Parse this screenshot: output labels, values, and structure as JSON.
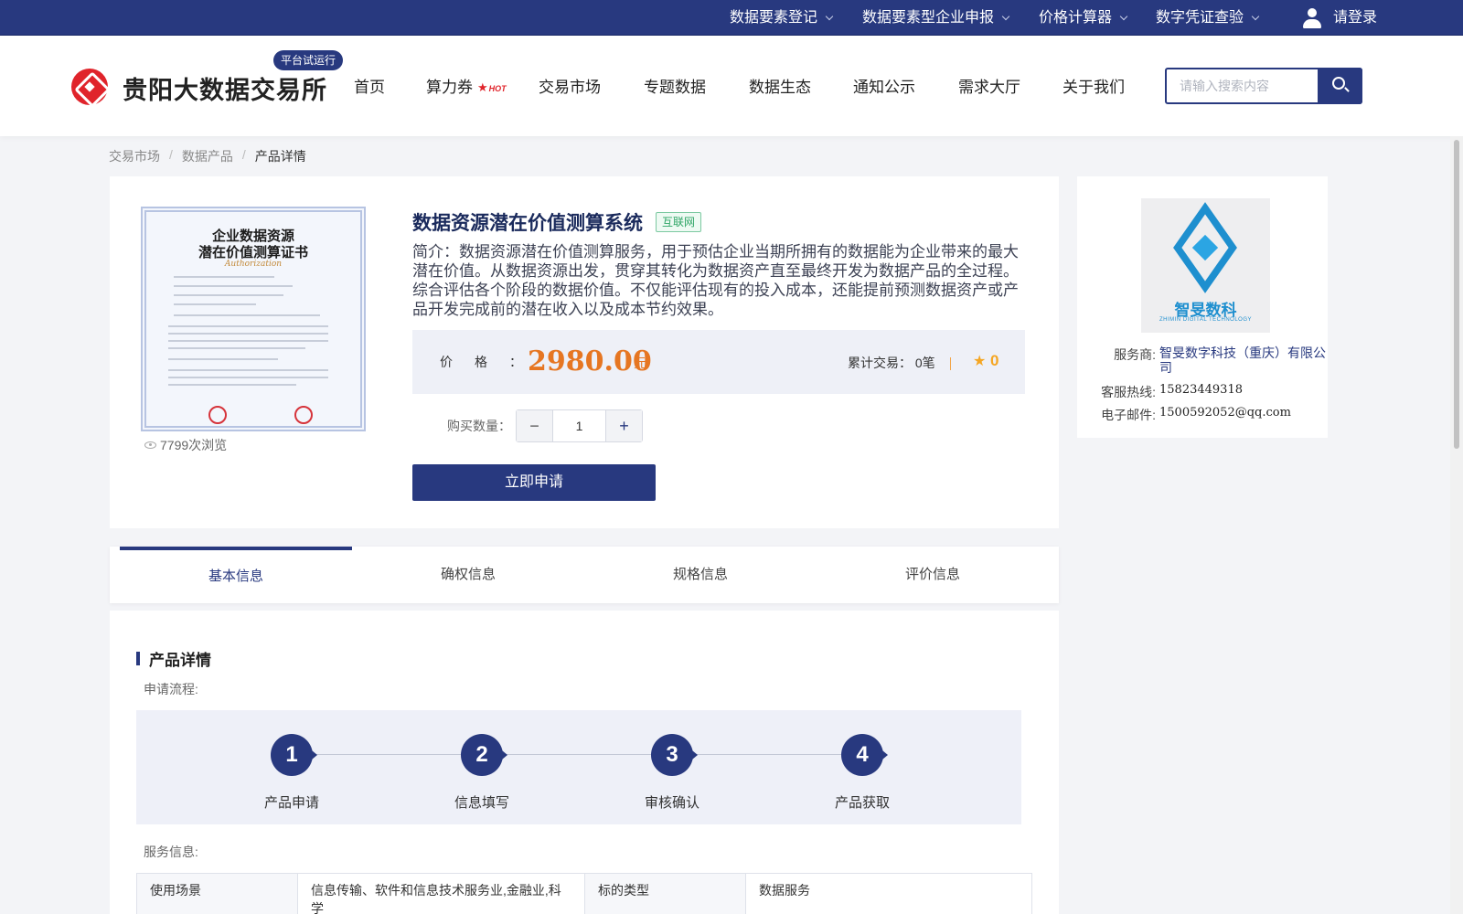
{
  "topbar": {
    "items": [
      {
        "label": "数据要素登记"
      },
      {
        "label": "数据要素型企业申报"
      },
      {
        "label": "价格计算器"
      },
      {
        "label": "数字凭证查验"
      }
    ],
    "login": "请登录"
  },
  "header": {
    "logo_text": "贵阳大数据交易所",
    "trial_badge": "平台试运行",
    "nav": [
      "首页",
      "算力券",
      "交易市场",
      "专题数据",
      "数据生态",
      "通知公示",
      "需求大厅",
      "关于我们"
    ],
    "hot_badge": "HOT",
    "search_placeholder": "请输入搜索内容"
  },
  "breadcrumb": [
    "交易市场",
    "数据产品",
    "产品详情"
  ],
  "product": {
    "certificate": {
      "title_line1": "企业数据资源",
      "title_line2": "潜在价值测算证书",
      "subtitle": "Authorization"
    },
    "views": "7799次浏览",
    "title": "数据资源潜在价值测算系统",
    "tag": "互联网",
    "intro": "简介：数据资源潜在价值测算服务，用于预估企业当期所拥有的数据能为企业带来的最大潜在价值。从数据资源出发，贯穿其转化为数据资产直至最终开发为数据产品的全过程。综合评估各个阶段的数据价值。不仅能评估现有的投入成本，还能提前预测数据资产或产品开发完成前的潜在收入以及成本节约效果。",
    "price_label": "价格：",
    "price": "2980.00",
    "price_unit": "元",
    "trades": "累计交易：  0笔",
    "rating": "0",
    "qty_label": "购买数量：",
    "qty_minus": "−",
    "qty_value": "1",
    "qty_plus": "+",
    "apply": "立即申请"
  },
  "provider": {
    "logo_name": "智旻数科",
    "logo_eng": "ZHIMIN DIGITAL TECHNOLOGY",
    "rows": [
      {
        "key": "服务商:",
        "value": "智旻数字科技（重庆）有限公司"
      },
      {
        "key": "客服热线:",
        "value": "15823449318"
      },
      {
        "key": "电子邮件:",
        "value": "1500592052@qq.com"
      }
    ]
  },
  "tabs": [
    "基本信息",
    "确权信息",
    "规格信息",
    "评价信息"
  ],
  "detail": {
    "section_title": "产品详情",
    "flow_label": "申请流程:",
    "steps": [
      {
        "num": "1",
        "label": "产品申请"
      },
      {
        "num": "2",
        "label": "信息填写"
      },
      {
        "num": "3",
        "label": "审核确认"
      },
      {
        "num": "4",
        "label": "产品获取"
      }
    ],
    "service_label": "服务信息:",
    "table": [
      [
        "使用场景",
        "信息传输、软件和信息技术服务业,金融业,科学",
        "标的类型",
        "数据服务"
      ]
    ]
  }
}
